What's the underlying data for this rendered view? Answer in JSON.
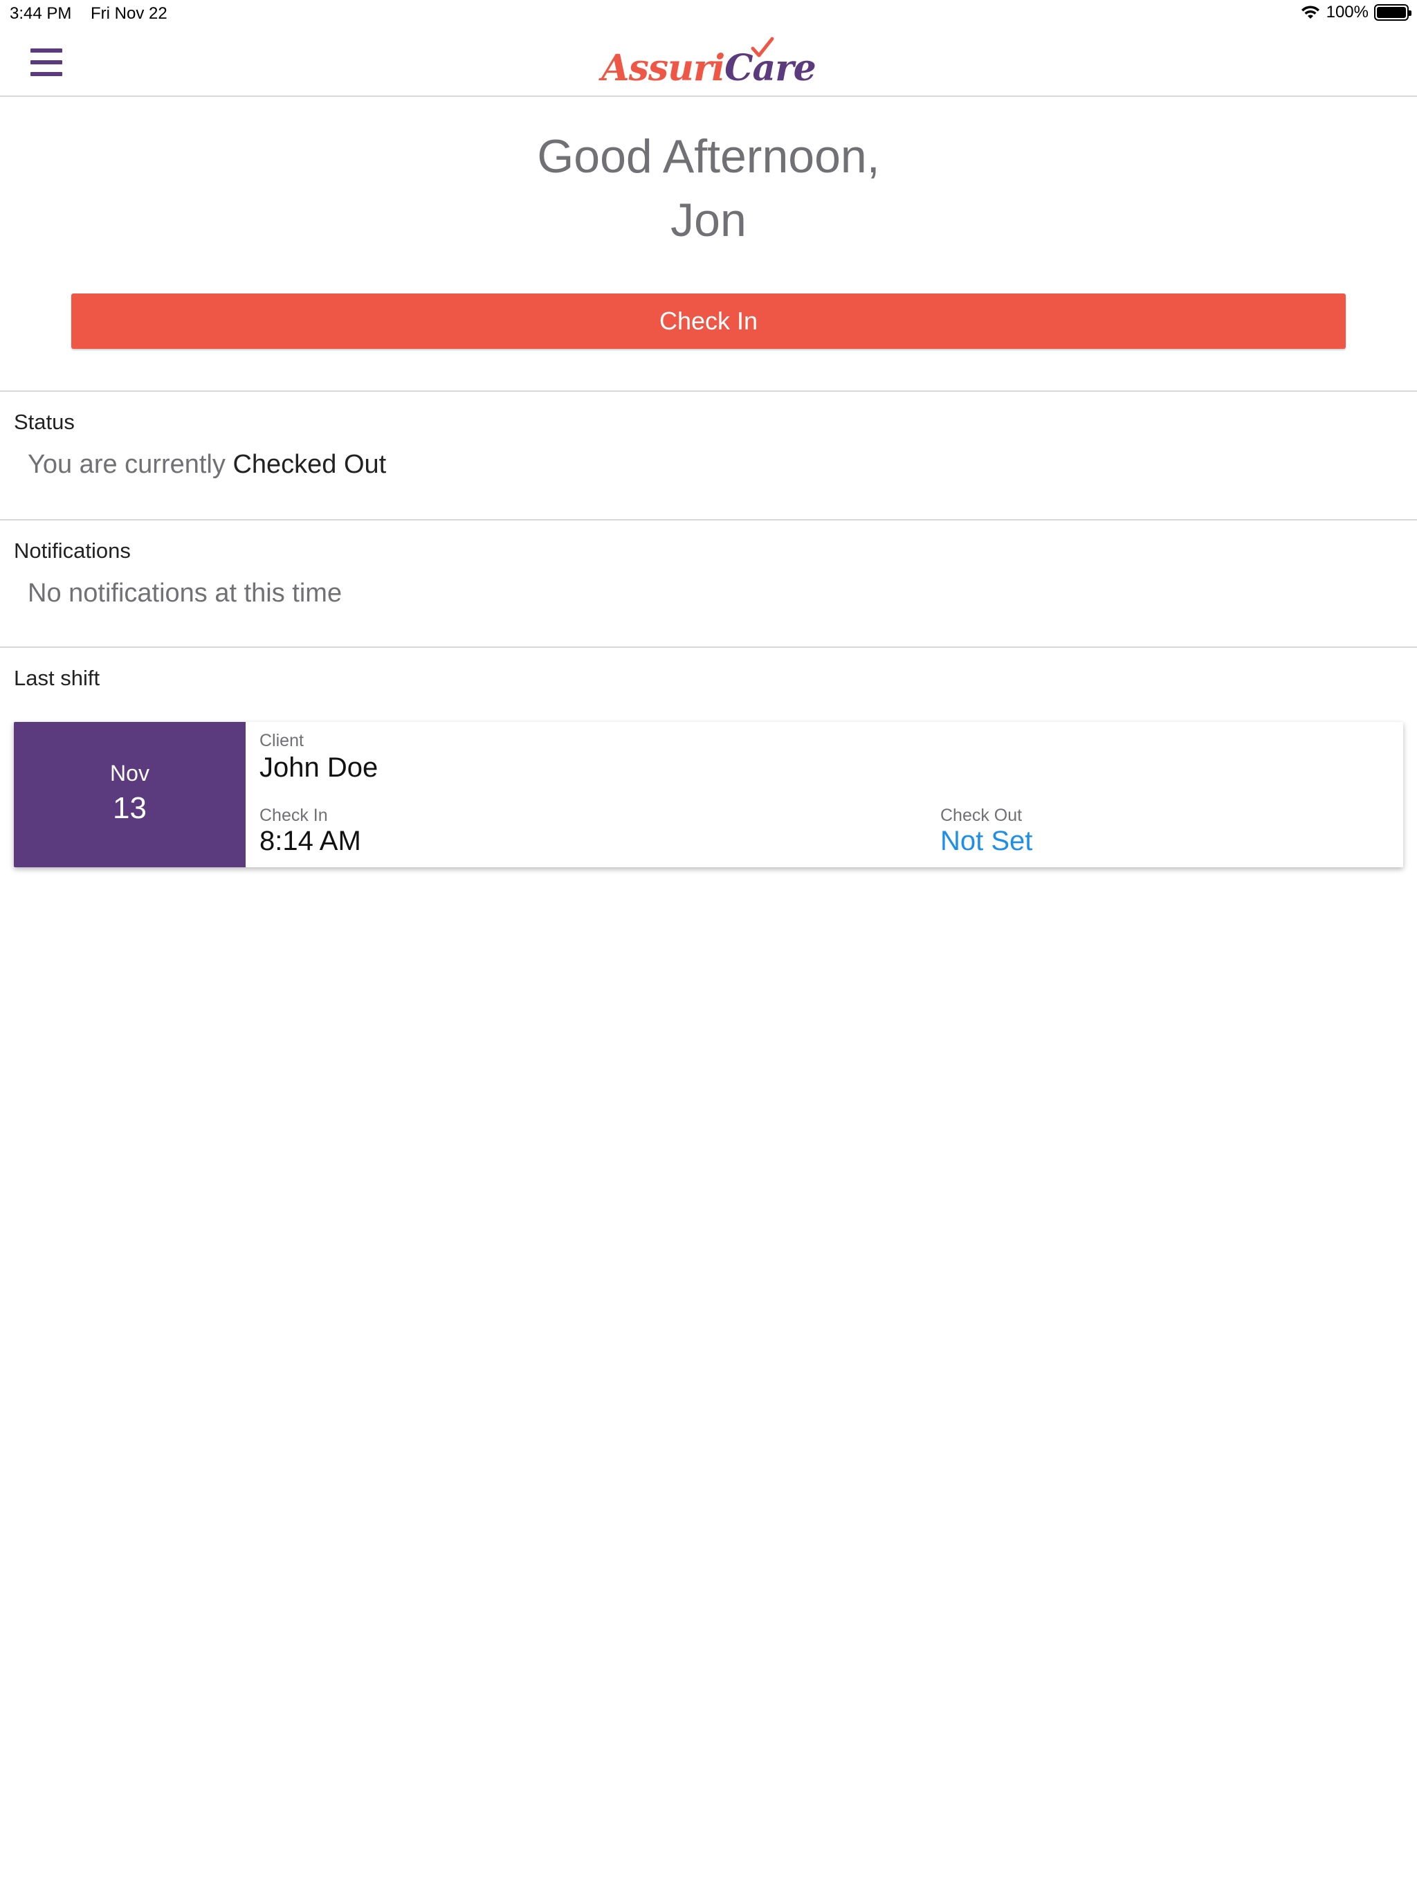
{
  "status_bar": {
    "time": "3:44 PM",
    "date": "Fri Nov 22",
    "battery": "100%",
    "wifi_icon": "wifi-icon",
    "battery_icon": "battery-icon"
  },
  "nav": {
    "menu_icon": "hamburger-menu-icon",
    "logo_part1": "Assuri",
    "logo_part2": "Care"
  },
  "greeting": {
    "line1": "Good Afternoon,",
    "line2": "Jon"
  },
  "check_in_button": "Check In",
  "status": {
    "heading": "Status",
    "prefix": "You are currently",
    "value": "Checked Out"
  },
  "notifications": {
    "heading": "Notifications",
    "message": "No notifications at this time"
  },
  "last_shift": {
    "heading": "Last shift",
    "month": "Nov",
    "day": "13",
    "client_label": "Client",
    "client_name": "John Doe",
    "check_in_label": "Check In",
    "check_in_value": "8:14 AM",
    "check_out_label": "Check Out",
    "check_out_value": "Not Set"
  },
  "colors": {
    "brand_purple": "#5b3a7e",
    "brand_red": "#ee5746",
    "link_blue": "#1e8fe8"
  }
}
